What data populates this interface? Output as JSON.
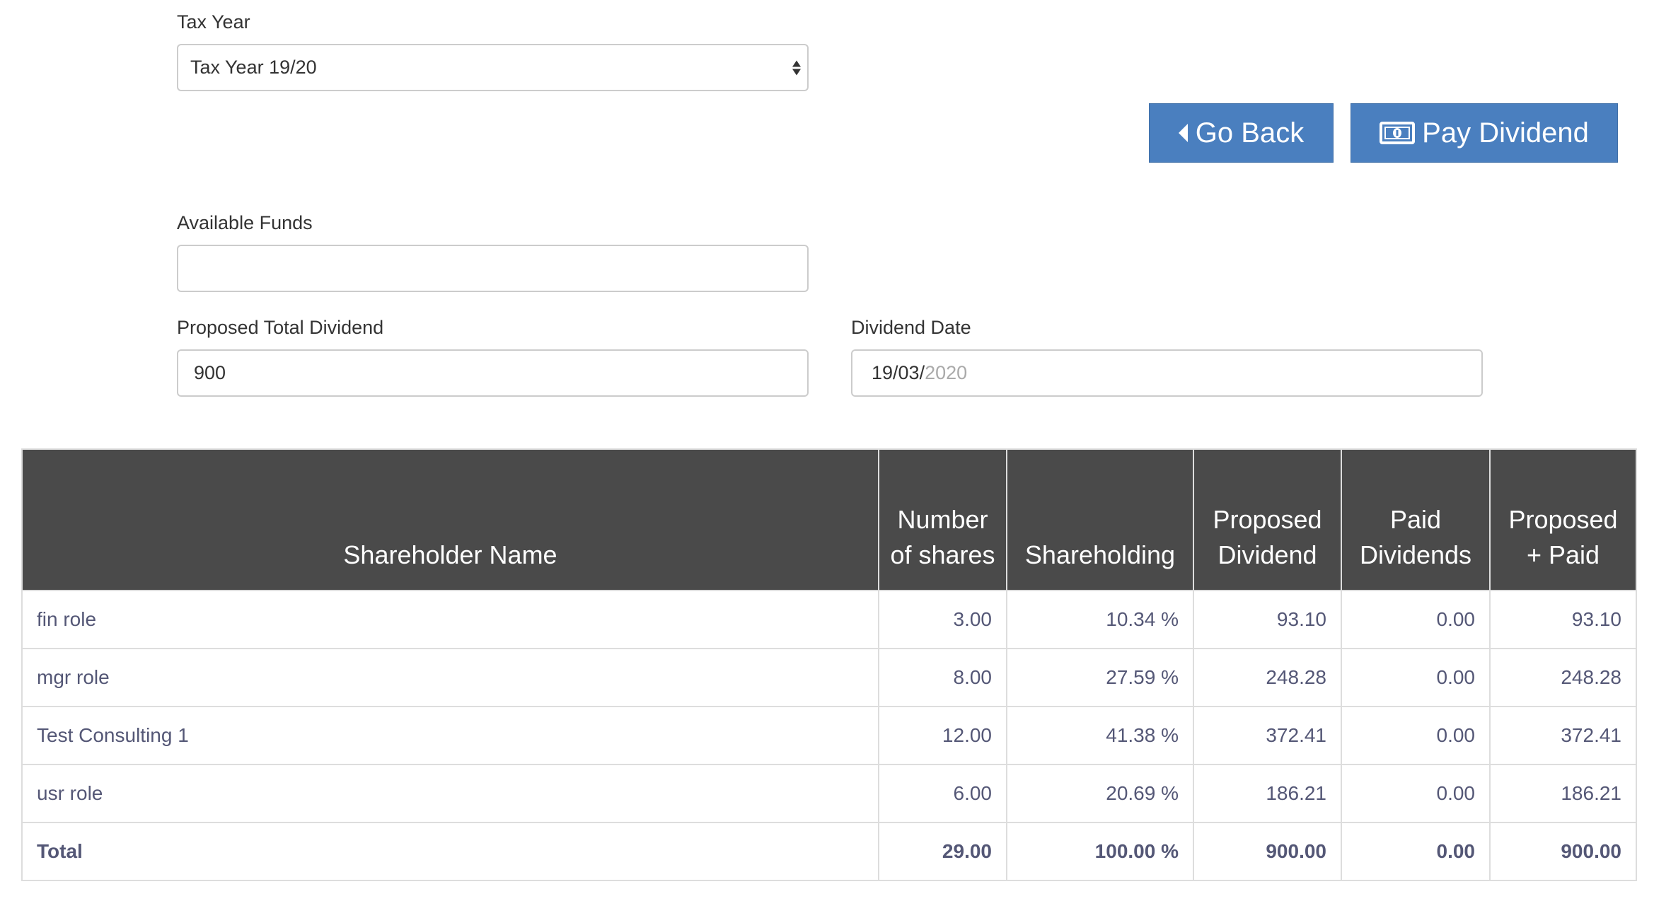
{
  "form": {
    "tax_year_label": "Tax Year",
    "tax_year_value": "Tax Year 19/20",
    "available_funds_label": "Available Funds",
    "available_funds_value": "",
    "proposed_total_label": "Proposed Total Dividend",
    "proposed_total_value": "900",
    "dividend_date_label": "Dividend Date",
    "dividend_date_value": "19/03/",
    "dividend_date_hint": "2020"
  },
  "buttons": {
    "go_back": "Go Back",
    "pay_dividend": "Pay Dividend"
  },
  "colors": {
    "button_bg": "#4a7fbf",
    "header_bg": "#4a4a4a",
    "cell_text": "#545776"
  },
  "icons": {
    "go_back": "caret-left-icon",
    "pay_dividend": "money-icon",
    "select": "select-arrows-icon"
  },
  "table": {
    "headers": [
      "Shareholder Name",
      "Number of shares",
      "Shareholding",
      "Proposed Dividend",
      "Paid Dividends",
      "Proposed + Paid"
    ],
    "rows": [
      [
        "fin role",
        "3.00",
        "10.34 %",
        "93.10",
        "0.00",
        "93.10"
      ],
      [
        "mgr role",
        "8.00",
        "27.59 %",
        "248.28",
        "0.00",
        "248.28"
      ],
      [
        "Test Consulting 1",
        "12.00",
        "41.38 %",
        "372.41",
        "0.00",
        "372.41"
      ],
      [
        "usr role",
        "6.00",
        "20.69 %",
        "186.21",
        "0.00",
        "186.21"
      ]
    ],
    "total": [
      "Total",
      "29.00",
      "100.00 %",
      "900.00",
      "0.00",
      "900.00"
    ]
  }
}
